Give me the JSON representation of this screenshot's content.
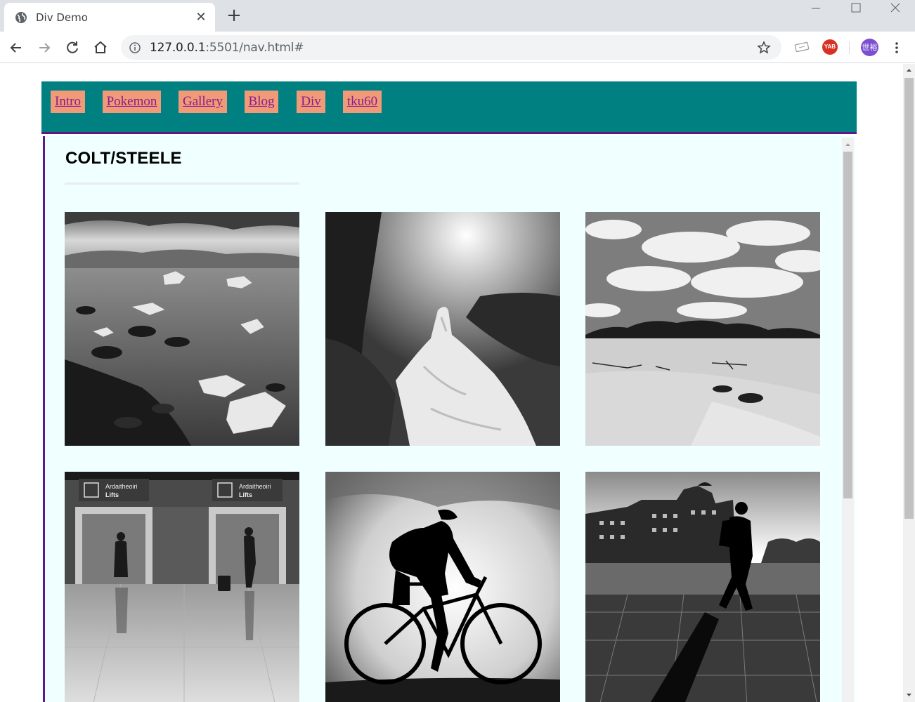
{
  "browser": {
    "tab_title": "Div Demo",
    "url_host": "127.0.0.1",
    "url_path": ":5501/nav.html#",
    "profile_label": "世裕",
    "extension_label": "YAB"
  },
  "nav": {
    "links": [
      "Intro",
      "Pokemon",
      "Gallery",
      "Blog",
      "Div",
      "tku60"
    ]
  },
  "content": {
    "title": "COLT/STEELE"
  },
  "gallery": {
    "photos": [
      {
        "subject": "glacier lagoon with ice chunks"
      },
      {
        "subject": "forest waterfall"
      },
      {
        "subject": "desert dunes with mountains"
      },
      {
        "subject": "airport lifts with travelers",
        "sign_text": "Ardaitheoiri",
        "sign_sub": "Lifts"
      },
      {
        "subject": "cyclist silhouette"
      },
      {
        "subject": "pedestrian with backpack by waterfront"
      }
    ]
  },
  "colors": {
    "nav_bg": "#008080",
    "nav_link_bg": "#f09a78",
    "nav_link_text": "#8a1d8e",
    "border_purple": "#5b1a86",
    "content_bg": "#f0ffff"
  }
}
